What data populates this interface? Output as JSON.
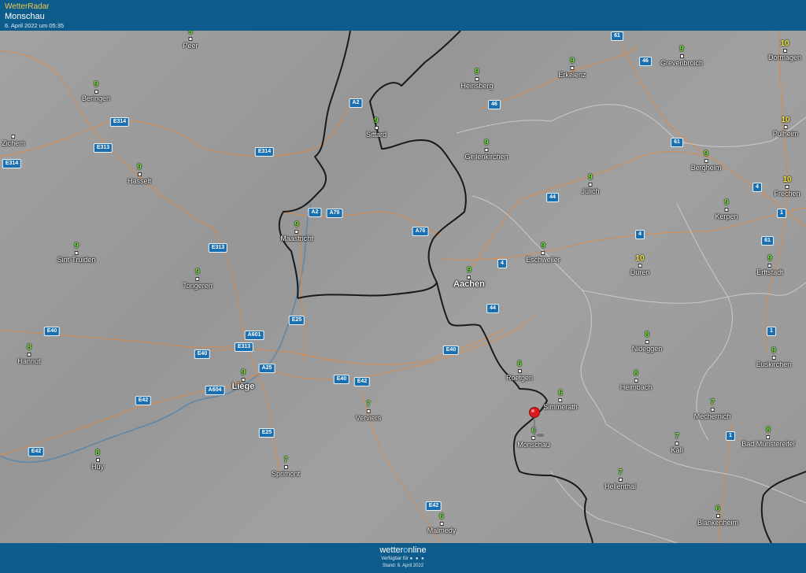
{
  "header": {
    "brand": "WetterRadar",
    "location": "Monschau",
    "timestamp": "6. April 2022 um 05:35"
  },
  "cities": [
    {
      "name": "Peer",
      "temp": "9"
    },
    {
      "name": "Beringen",
      "temp": "9"
    },
    {
      "name": "Hasselt",
      "temp": "9"
    },
    {
      "name": "Zichem",
      "temp": ""
    },
    {
      "name": "Sint-Truiden",
      "temp": "9"
    },
    {
      "name": "Tongeren",
      "temp": "9"
    },
    {
      "name": "Maastricht",
      "temp": "9"
    },
    {
      "name": "Hannut",
      "temp": "8"
    },
    {
      "name": "Liège",
      "temp": "9"
    },
    {
      "name": "Huy",
      "temp": "8"
    },
    {
      "name": "Sprimont",
      "temp": "7"
    },
    {
      "name": "Verviers",
      "temp": "7"
    },
    {
      "name": "Malmedy",
      "temp": "6"
    },
    {
      "name": "Sittard",
      "temp": "9"
    },
    {
      "name": "Heinsberg",
      "temp": "9"
    },
    {
      "name": "Geilenkirchen",
      "temp": "9"
    },
    {
      "name": "Erkelenz",
      "temp": "9"
    },
    {
      "name": "Grevenbroich",
      "temp": "9"
    },
    {
      "name": "Dormagen",
      "temp": "10"
    },
    {
      "name": "Pulheim",
      "temp": "10"
    },
    {
      "name": "Bergheim",
      "temp": "9"
    },
    {
      "name": "Frechen",
      "temp": "10"
    },
    {
      "name": "Kerpen",
      "temp": "9"
    },
    {
      "name": "Jülich",
      "temp": "9"
    },
    {
      "name": "Eschweiler",
      "temp": "9"
    },
    {
      "name": "Aachen",
      "temp": "9"
    },
    {
      "name": "Düren",
      "temp": "10"
    },
    {
      "name": "Erftstadt",
      "temp": "9"
    },
    {
      "name": "Roetgen",
      "temp": "6"
    },
    {
      "name": "Simmerath",
      "temp": "6"
    },
    {
      "name": "Monschau",
      "temp": "6"
    },
    {
      "name": "Nideggen",
      "temp": "8"
    },
    {
      "name": "Heimbach",
      "temp": "8"
    },
    {
      "name": "Euskirchen",
      "temp": "9"
    },
    {
      "name": "Mechernich",
      "temp": "7"
    },
    {
      "name": "Kall",
      "temp": "7"
    },
    {
      "name": "Bad Münstereifel",
      "temp": "8"
    },
    {
      "name": "Hellenthal",
      "temp": "7"
    },
    {
      "name": "Blankenheim",
      "temp": "6"
    }
  ],
  "roads": [
    "61",
    "46",
    "A2",
    "46",
    "E314",
    "E313",
    "E314",
    "E314",
    "61",
    "4",
    "A2",
    "A79",
    "A76",
    "44",
    "1",
    "E313",
    "61",
    "4",
    "4",
    "1",
    "E25",
    "A601",
    "E40",
    "E313",
    "E40",
    "A25",
    "E40",
    "A604",
    "E42",
    "E42",
    "E25",
    "E42",
    "44",
    "E40",
    "1",
    "E42"
  ],
  "footer": {
    "logo_part1": "wetter",
    "logo_o": "o",
    "logo_part2": "nline",
    "available": "Verfügbar für",
    "available_dots": "● ● ●",
    "stand": "Stand: 6. April 2022"
  },
  "colors": {
    "header_bg": "#0e5c8c",
    "brand": "#f2c94c",
    "temp_normal": "#6fe03a",
    "temp_warm": "#f4ee3a",
    "road_sign": "#1a6fb0",
    "road_line": "#d98a4a",
    "border": "#1a1a1a"
  },
  "icons": [
    "location-pin-icon"
  ]
}
